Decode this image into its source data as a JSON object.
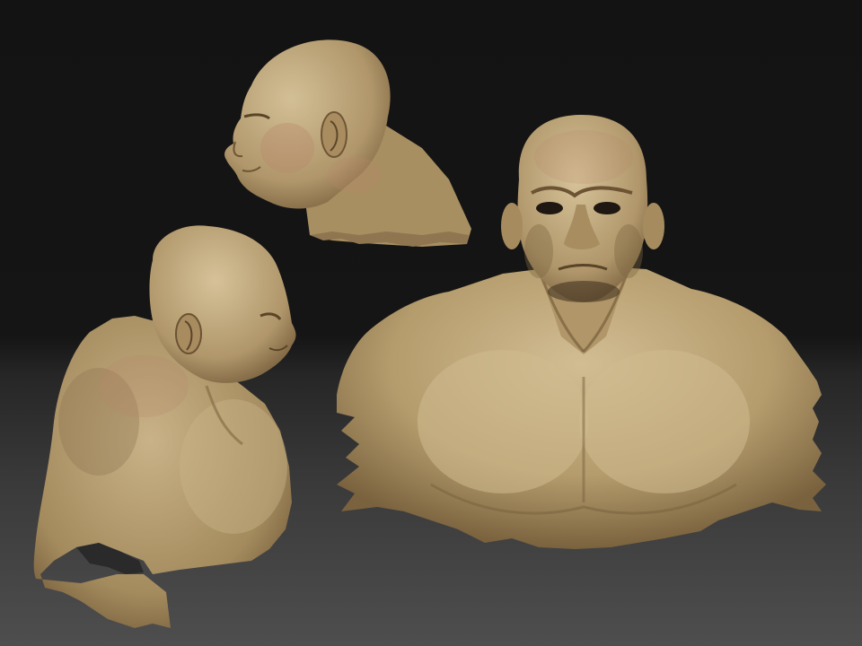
{
  "scene": {
    "views": [
      {
        "name": "side-profile-head",
        "description_id": "profile"
      },
      {
        "name": "three-quarter-back",
        "description_id": "back"
      },
      {
        "name": "front-torso",
        "description_id": "front"
      }
    ],
    "colors": {
      "skin_light": "#c8b287",
      "skin_mid": "#a89062",
      "skin_dark": "#6b5535",
      "skin_red": "#b98a6a",
      "bg_top": "#131313",
      "bg_bottom": "#4e4e4e"
    }
  }
}
